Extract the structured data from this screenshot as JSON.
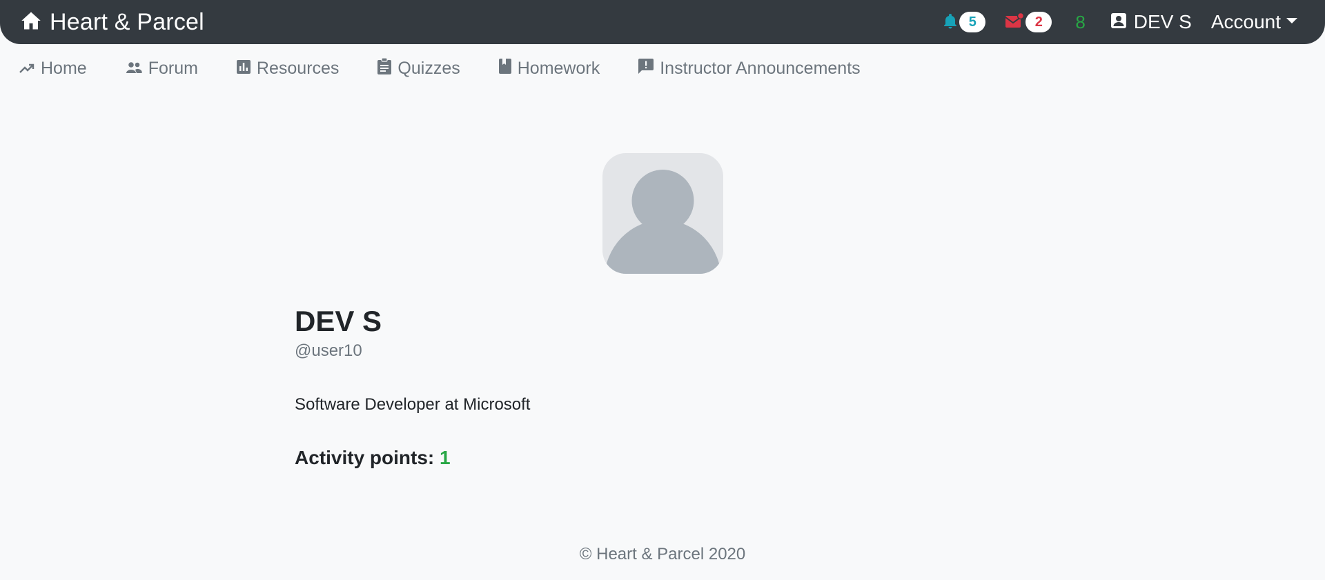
{
  "header": {
    "brand": "Heart & Parcel",
    "notifications_count": "5",
    "messages_count": "2",
    "points": "8",
    "user_name": "DEV S",
    "account_label": "Account"
  },
  "nav": {
    "items": [
      {
        "label": "Home",
        "icon": "trending-up-icon"
      },
      {
        "label": "Forum",
        "icon": "people-icon"
      },
      {
        "label": "Resources",
        "icon": "bar-chart-icon"
      },
      {
        "label": "Quizzes",
        "icon": "clipboard-icon"
      },
      {
        "label": "Homework",
        "icon": "book-icon"
      },
      {
        "label": "Instructor Announcements",
        "icon": "announcement-icon"
      }
    ]
  },
  "profile": {
    "name": "DEV S",
    "handle": "@user10",
    "bio": "Software Developer at Microsoft",
    "activity_label": "Activity points:",
    "activity_value": "1"
  },
  "footer": {
    "text": "© Heart & Parcel 2020"
  },
  "colors": {
    "navbar": "#343a40",
    "background": "#f8f9fa",
    "teal": "#17a2b8",
    "red": "#dc3545",
    "green": "#28a745",
    "muted": "#6c757d"
  }
}
